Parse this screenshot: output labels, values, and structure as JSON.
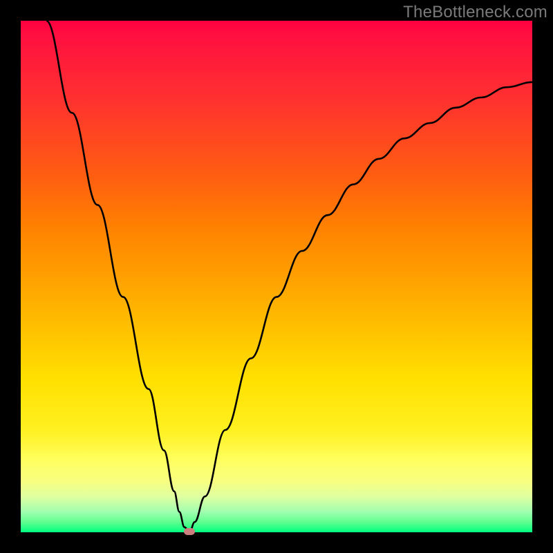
{
  "watermark": "TheBottleneck.com",
  "chart_data": {
    "type": "line",
    "title": "",
    "xlabel": "",
    "ylabel": "",
    "xlim": [
      0,
      100
    ],
    "ylim": [
      0,
      100
    ],
    "series": [
      {
        "name": "curve",
        "x": [
          5,
          10,
          15,
          20,
          25,
          28,
          30,
          31,
          32,
          33,
          34,
          36,
          40,
          45,
          50,
          55,
          60,
          65,
          70,
          75,
          80,
          85,
          90,
          95,
          100
        ],
        "values": [
          100,
          82,
          64,
          46,
          28,
          16,
          8,
          4,
          1,
          0,
          2,
          7,
          20,
          34,
          46,
          55,
          62,
          68,
          73,
          77,
          80,
          83,
          85,
          87,
          88
        ]
      }
    ],
    "marker": {
      "x": 33,
      "y": 0,
      "color": "#cb7f7f"
    },
    "background_gradient": {
      "orientation": "vertical",
      "stops": [
        {
          "pos": 0.0,
          "color": "#ff0040"
        },
        {
          "pos": 0.4,
          "color": "#ff8000"
        },
        {
          "pos": 0.7,
          "color": "#ffe000"
        },
        {
          "pos": 0.9,
          "color": "#f0ff90"
        },
        {
          "pos": 1.0,
          "color": "#00ff80"
        }
      ]
    },
    "frame_color": "#000000"
  }
}
